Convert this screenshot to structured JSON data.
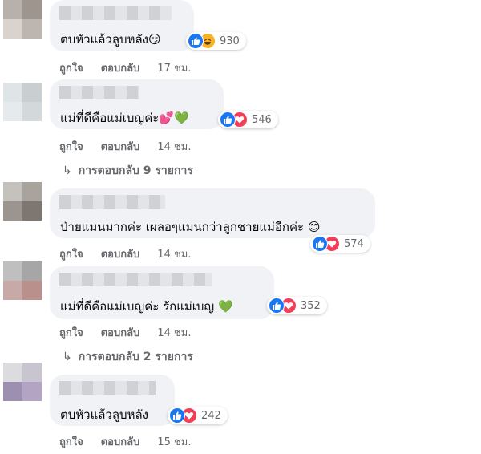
{
  "colors": {
    "bubble_bg": "#f0f2f5",
    "meta_text": "#65676b",
    "like_blue": "#1877f2",
    "love_red": "#f33e58",
    "haha_yellow": "#f7b125"
  },
  "actions": {
    "like_label": "ถูกใจ",
    "reply_label": "ตอบกลับ"
  },
  "comments": [
    {
      "text": "ตบหัวแล้วลูบหลัง",
      "emoji": "😏",
      "reactions": [
        "like-icon",
        "haha-icon"
      ],
      "reaction_count": "930",
      "time": "17 ชม."
    },
    {
      "text": "แม่ที่ดีคือแม่เบญค่ะ",
      "emoji": "💕💚",
      "reactions": [
        "like-icon",
        "love-icon"
      ],
      "reaction_count": "546",
      "time": "14 ชม.",
      "replies_text": "การตอบกลับ 9 รายการ"
    },
    {
      "text": "ป่ายแมนมากค่ะ เผลอๆแมนกว่าลูกชายแม่อีกค่ะ",
      "emoji": "😊",
      "reactions": [
        "like-icon",
        "love-icon"
      ],
      "reaction_count": "574",
      "time": "14 ชม."
    },
    {
      "text": "แม่ที่ดีคือแม่เบญค่ะ รักแม่เบญ",
      "emoji": "💚",
      "reactions": [
        "like-icon",
        "love-icon"
      ],
      "reaction_count": "352",
      "time": "14 ชม.",
      "replies_text": "การตอบกลับ 2 รายการ"
    },
    {
      "text": "ตบหัวแล้วลูบหลัง",
      "emoji": "",
      "reactions": [
        "like-icon",
        "love-icon"
      ],
      "reaction_count": "242",
      "time": "15 ชม."
    }
  ]
}
